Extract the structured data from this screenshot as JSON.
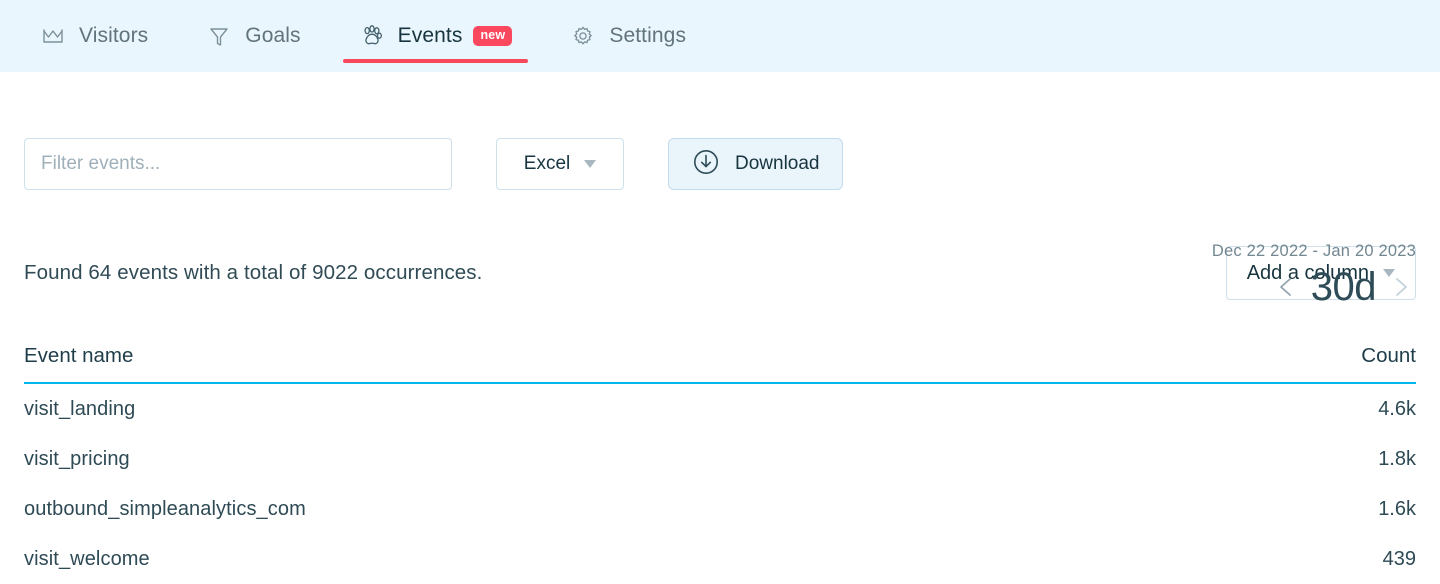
{
  "nav": {
    "tabs": [
      {
        "label": "Visitors",
        "icon": "chart-line-icon",
        "active": false,
        "badge": null
      },
      {
        "label": "Goals",
        "icon": "funnel-icon",
        "active": false,
        "badge": null
      },
      {
        "label": "Events",
        "icon": "paw-print-icon",
        "active": true,
        "badge": "new"
      },
      {
        "label": "Settings",
        "icon": "gear-icon",
        "active": false,
        "badge": null
      }
    ],
    "active_underline_color": "#f8485e",
    "badge_color": "#fa495e",
    "background_color": "#eaf6fd"
  },
  "toolbar": {
    "filter": {
      "value": "",
      "placeholder": "Filter events..."
    },
    "export_format": {
      "selected": "Excel"
    },
    "download_label": "Download"
  },
  "daterange": {
    "range_text": "Dec 22 2022 - Jan 20 2023",
    "period": "30d",
    "prev_label": "‹",
    "next_label": "›"
  },
  "summary": {
    "found_text": "Found 64 events with a total of 9022 occurrences.",
    "events_count": 64,
    "total_occurrences": 9022
  },
  "add_column": {
    "label": "Add a column"
  },
  "table": {
    "columns": [
      "Event name",
      "Count"
    ],
    "header_rule_color": "#05b7ed",
    "rows": [
      {
        "name": "visit_landing",
        "count": "4.6k"
      },
      {
        "name": "visit_pricing",
        "count": "1.8k"
      },
      {
        "name": "outbound_simpleanalytics_com",
        "count": "1.6k"
      },
      {
        "name": "visit_welcome",
        "count": "439"
      }
    ]
  }
}
